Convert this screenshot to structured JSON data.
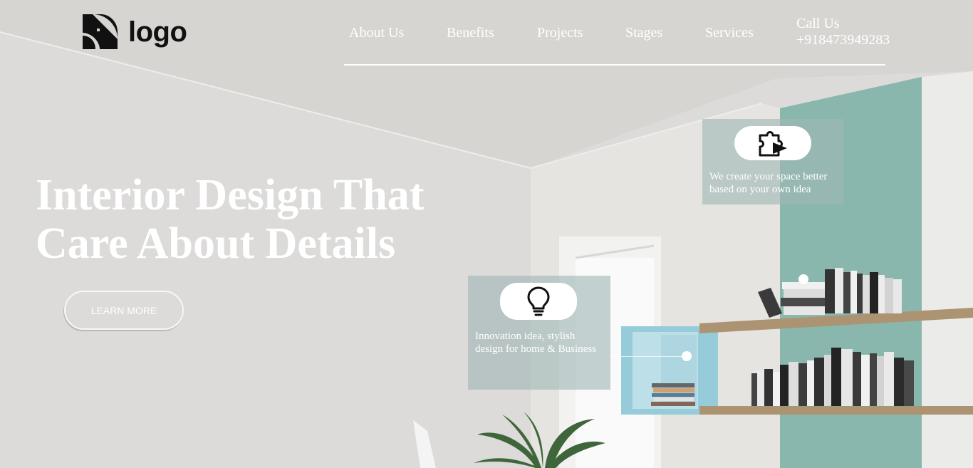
{
  "brand": {
    "logo_text": "logo"
  },
  "nav": {
    "items": [
      "About Us",
      "Benefits",
      "Projects",
      "Stages",
      "Services"
    ],
    "call_label": "Call Us",
    "phone": "+918473949283"
  },
  "hero": {
    "title_line1": "Interior Design That",
    "title_line2": "Care About Details",
    "cta_label": "LEARN MORE"
  },
  "cards": [
    {
      "icon": "puzzle-icon",
      "text_line1": "We create your space better",
      "text_line2": "based on your own idea"
    },
    {
      "icon": "lightbulb-icon",
      "text_line1": "Innovation idea, stylish",
      "text_line2": "design for home & Business"
    }
  ],
  "colors": {
    "accent_teal": "#7fb1a6",
    "cabinet_blue": "#8ec8d6",
    "wood": "#a58a67",
    "text_white": "#ffffff"
  }
}
